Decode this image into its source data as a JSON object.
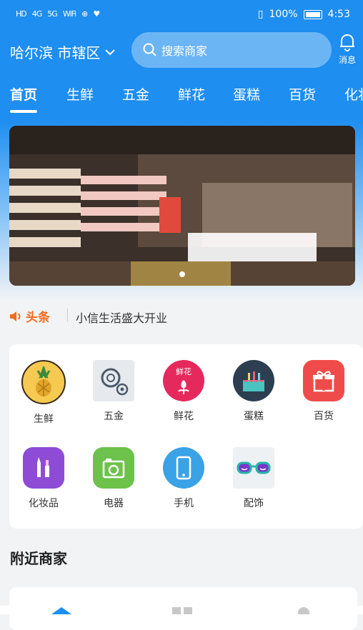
{
  "status_bar": {
    "left_items": [
      "HD",
      "4G",
      "5G",
      "WiFi",
      "⊕",
      "♥"
    ],
    "battery": "100%",
    "time": "4:53"
  },
  "header": {
    "city": "哈尔滨 市辖区",
    "search_placeholder": "搜索商家",
    "message_label": "消息"
  },
  "categories": [
    {
      "label": "首页",
      "active": true
    },
    {
      "label": "生鲜"
    },
    {
      "label": "五金"
    },
    {
      "label": "鲜花"
    },
    {
      "label": "蛋糕"
    },
    {
      "label": "百货"
    },
    {
      "label": "化妆"
    }
  ],
  "news": {
    "badge": "头条",
    "text": "小信生活盛大开业"
  },
  "grid": [
    {
      "label": "生鲜",
      "icon": "pineapple-icon",
      "color": "#f6c950"
    },
    {
      "label": "五金",
      "icon": "gears-icon",
      "color": "#e6e9ee"
    },
    {
      "label": "鲜花",
      "icon": "flower-icon",
      "color": "#e6295c",
      "icon_text": "鲜花"
    },
    {
      "label": "蛋糕",
      "icon": "cake-icon",
      "color": "#2c3e50"
    },
    {
      "label": "百货",
      "icon": "gift-icon",
      "color": "#f04b4b"
    },
    {
      "label": "化妆品",
      "icon": "cosmetics-icon",
      "color": "#8d4bd6"
    },
    {
      "label": "电器",
      "icon": "appliance-icon",
      "color": "#6cc24a"
    },
    {
      "label": "手机",
      "icon": "phone-icon",
      "color": "#3aa2e6"
    },
    {
      "label": "配饰",
      "icon": "glasses-icon",
      "color": "#27b6a8"
    }
  ],
  "section_title": "附近商家"
}
